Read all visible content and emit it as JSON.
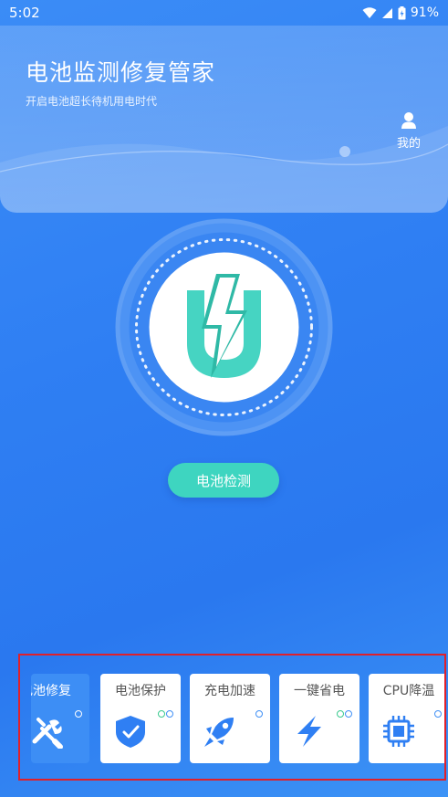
{
  "status_bar": {
    "time": "5:02",
    "battery": "91%",
    "icons": [
      "wifi-icon",
      "signal-icon",
      "battery-icon"
    ]
  },
  "header": {
    "title": "电池监测修复管家",
    "subtitle": "开启电池超长待机用电时代",
    "mine_label": "我的",
    "mine_icon": "user-icon"
  },
  "dial": {
    "logo_icon": "lightning-u-logo-icon",
    "accent_color": "#46d4c2"
  },
  "detect_button": {
    "label": "电池检测"
  },
  "tools": [
    {
      "label": "电池修复",
      "icon": "wrench-screwdriver-icon",
      "dots": [
        "white"
      ]
    },
    {
      "label": "电池保护",
      "icon": "shield-check-icon",
      "dots": [
        "green",
        "blue"
      ]
    },
    {
      "label": "充电加速",
      "icon": "rocket-icon",
      "dots": [
        "blue"
      ]
    },
    {
      "label": "一键省电",
      "icon": "lightning-icon",
      "dots": [
        "green",
        "blue"
      ]
    },
    {
      "label": "CPU降温",
      "icon": "cpu-chip-icon",
      "dots": [
        "blue"
      ]
    }
  ],
  "colors": {
    "primary_blue": "#2f7ff3",
    "teal": "#3ed5c0",
    "highlight_border": "#e0202a"
  }
}
